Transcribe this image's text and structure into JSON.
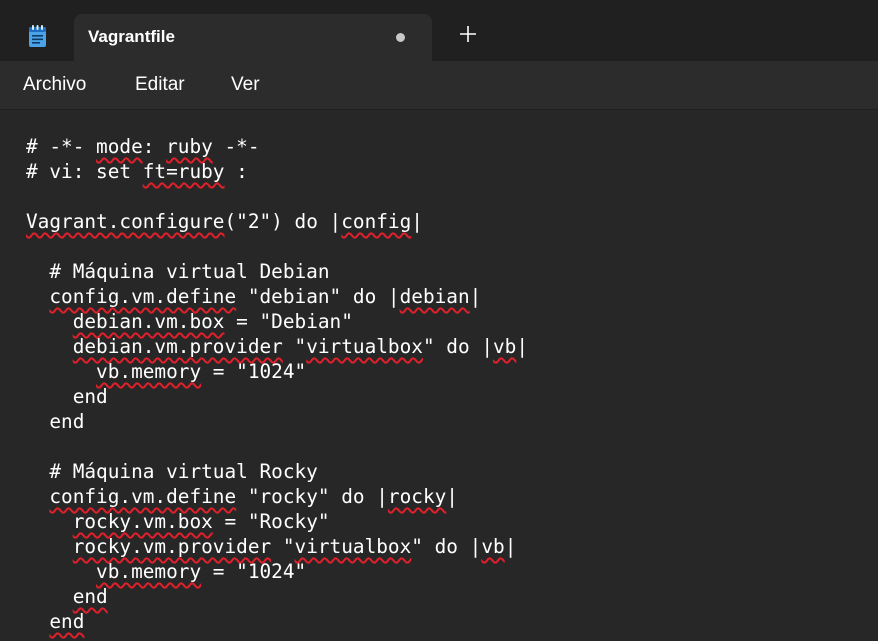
{
  "window": {
    "tab_title": "Vagrantfile",
    "unsaved_indicator": "dot",
    "app_icon": "notepad-icon",
    "new_tab_icon": "plus-icon"
  },
  "menu": {
    "items": [
      "Archivo",
      "Editar",
      "Ver"
    ]
  },
  "editor": {
    "spellcheck_color": "#e0202a",
    "lines": [
      [
        {
          "t": "# -*- "
        },
        {
          "t": "mode",
          "sq": true
        },
        {
          "t": ": "
        },
        {
          "t": "ruby",
          "sq": true
        },
        {
          "t": " -*-"
        }
      ],
      [
        {
          "t": "# vi: set "
        },
        {
          "t": "ft=ruby",
          "sq": true
        },
        {
          "t": " :"
        }
      ],
      [],
      [
        {
          "t": "Vagrant.configure",
          "sq": true
        },
        {
          "t": "(\"2\") do |"
        },
        {
          "t": "config",
          "sq": true
        },
        {
          "t": "|"
        }
      ],
      [],
      [
        {
          "t": "  # Máquina virtual Debian"
        }
      ],
      [
        {
          "t": "  "
        },
        {
          "t": "config.vm.define",
          "sq": true
        },
        {
          "t": " \"debian\" do |"
        },
        {
          "t": "debian",
          "sq": true
        },
        {
          "t": "|"
        }
      ],
      [
        {
          "t": "    "
        },
        {
          "t": "debian.vm.box",
          "sq": true
        },
        {
          "t": " = \"Debian\""
        }
      ],
      [
        {
          "t": "    "
        },
        {
          "t": "debian.vm.provider",
          "sq": true
        },
        {
          "t": " \""
        },
        {
          "t": "virtualbox",
          "sq": true
        },
        {
          "t": "\" do |"
        },
        {
          "t": "vb",
          "sq": true
        },
        {
          "t": "|"
        }
      ],
      [
        {
          "t": "      "
        },
        {
          "t": "vb.memory",
          "sq": true
        },
        {
          "t": " = \"1024\""
        }
      ],
      [
        {
          "t": "    end"
        }
      ],
      [
        {
          "t": "  end"
        }
      ],
      [],
      [
        {
          "t": "  # Máquina virtual Rocky"
        }
      ],
      [
        {
          "t": "  "
        },
        {
          "t": "config.vm.define",
          "sq": true
        },
        {
          "t": " \"rocky\" do |"
        },
        {
          "t": "rocky",
          "sq": true
        },
        {
          "t": "|"
        }
      ],
      [
        {
          "t": "    "
        },
        {
          "t": "rocky.vm.box",
          "sq": true
        },
        {
          "t": " = \"Rocky\""
        }
      ],
      [
        {
          "t": "    "
        },
        {
          "t": "rocky.vm.provider",
          "sq": true
        },
        {
          "t": " \""
        },
        {
          "t": "virtualbox",
          "sq": true
        },
        {
          "t": "\" do |"
        },
        {
          "t": "vb",
          "sq": true
        },
        {
          "t": "|"
        }
      ],
      [
        {
          "t": "      "
        },
        {
          "t": "vb.memory",
          "sq": true
        },
        {
          "t": " = \"1024\""
        }
      ],
      [
        {
          "t": "    "
        },
        {
          "t": "end",
          "sq": true
        }
      ],
      [
        {
          "t": "  "
        },
        {
          "t": "end",
          "sq": true
        }
      ]
    ]
  }
}
